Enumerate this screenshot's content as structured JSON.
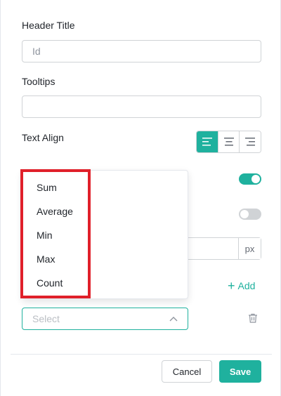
{
  "form": {
    "header_title_label": "Header Title",
    "header_title_value": "Id",
    "tooltips_label": "Tooltips",
    "tooltips_value": "",
    "text_align_label": "Text Align",
    "text_align_options": [
      "left-align-icon",
      "center-align-icon",
      "right-align-icon"
    ],
    "text_align_selected": "left",
    "toggle_1_on": true,
    "toggle_2_on": false,
    "width_unit": "px",
    "add_label": "Add",
    "select_placeholder": "Select"
  },
  "dropdown": {
    "options": [
      "Sum",
      "Average",
      "Min",
      "Max",
      "Count"
    ]
  },
  "footer": {
    "cancel_label": "Cancel",
    "save_label": "Save"
  },
  "colors": {
    "accent": "#1fb19e",
    "highlight": "#e0202a",
    "border": "#d0d3d6"
  }
}
